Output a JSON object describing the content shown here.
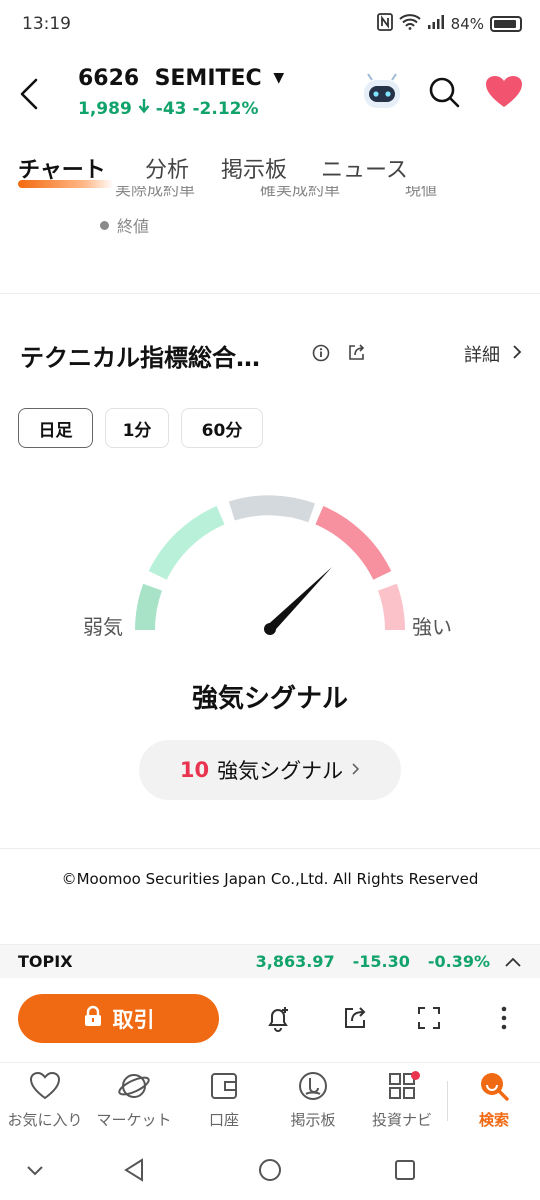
{
  "status": {
    "time": "13:19",
    "battery": "84%"
  },
  "header": {
    "code": "6626",
    "name": "SEMITEC",
    "price": "1,989",
    "change": "-43",
    "change_pct": "-2.12%"
  },
  "tabs": [
    {
      "label": "チャート",
      "active": true
    },
    {
      "label": "分析"
    },
    {
      "label": "掲示板"
    },
    {
      "label": "ニュース"
    }
  ],
  "legend": {
    "partial": [
      "実際成約単",
      "確実成約単",
      "現値"
    ],
    "final_label": "終値"
  },
  "technical": {
    "title": "テクニカル指標総合…",
    "detail_label": "詳細",
    "timeframes": [
      {
        "label": "日足",
        "active": true
      },
      {
        "label": "1分"
      },
      {
        "label": "60分"
      }
    ],
    "gauge_weak": "弱気",
    "gauge_strong": "強い",
    "signal_label": "強気シグナル",
    "signal_count": "10",
    "signal_button_label": "強気シグナル"
  },
  "copyright": "©Moomoo Securities Japan Co.,Ltd. All Rights Reserved",
  "index_bar": {
    "name": "TOPIX",
    "value": "3,863.97",
    "change": "-15.30",
    "change_pct": "-0.39%"
  },
  "actions": {
    "trade_label": "取引"
  },
  "bottom_nav": [
    {
      "label": "お気に入り",
      "icon": "heart-outline-icon"
    },
    {
      "label": "マーケット",
      "icon": "planet-icon"
    },
    {
      "label": "口座",
      "icon": "wallet-icon"
    },
    {
      "label": "掲示板",
      "icon": "board-icon"
    },
    {
      "label": "投資ナビ",
      "icon": "grid-icon"
    },
    {
      "label": "検索",
      "icon": "search-icon",
      "active": true
    }
  ],
  "colors": {
    "accent": "#f06a14",
    "down": "#11a36b",
    "up": "#e9334f"
  }
}
